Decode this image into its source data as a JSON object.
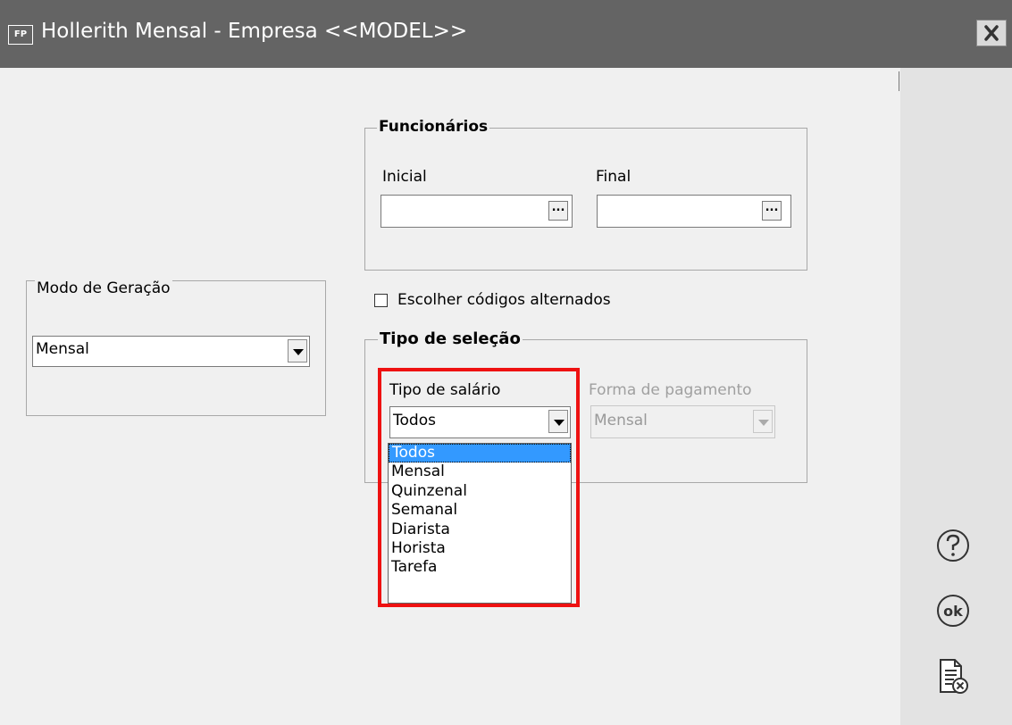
{
  "window": {
    "app_badge": "FP",
    "title": "Hollerith Mensal - Empresa <<MODEL>>"
  },
  "funcionarios": {
    "legend": "Funcionários",
    "inicial_label": "Inicial",
    "final_label": "Final",
    "inicial_value": "",
    "final_value": "",
    "lookup_label": "..."
  },
  "modo_geracao": {
    "legend": "Modo de Geração",
    "selected": "Mensal"
  },
  "escolher_codigos": {
    "label": "Escolher códigos alternados",
    "checked": false
  },
  "tipo_selecao": {
    "legend": "Tipo de seleção",
    "tipo_salario_label": "Tipo de salário",
    "tipo_salario_selected": "Todos",
    "forma_pagamento_label": "Forma de pagamento",
    "forma_pagamento_selected": "Mensal",
    "forma_pagamento_disabled": true
  },
  "dropdown": {
    "options": [
      "Todos",
      "Mensal",
      "Quinzenal",
      "Semanal",
      "Diarista",
      "Horista",
      "Tarefa"
    ],
    "highlighted": "Todos"
  },
  "side_actions": {
    "help_icon": "question-circle-icon",
    "ok_icon": "ok-circle-icon",
    "cancel_icon": "document-cancel-icon"
  },
  "colors": {
    "titlebar": "#646464",
    "selection": "#3399ff",
    "highlight_frame": "#ee1111"
  }
}
